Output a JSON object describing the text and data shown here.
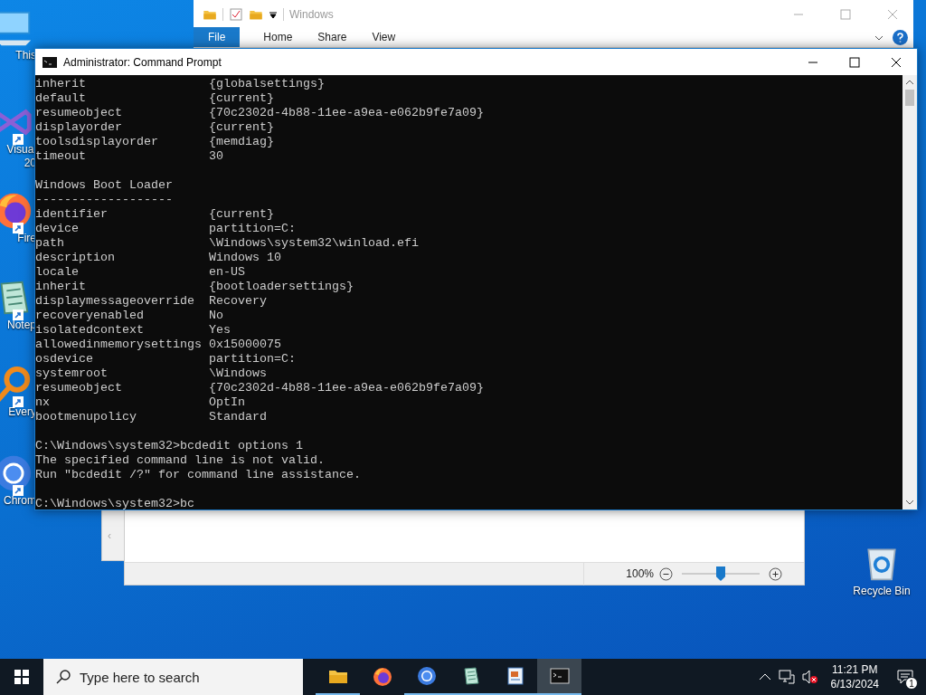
{
  "desktop_icons": [
    {
      "kind": "computer",
      "shortcut": false,
      "lines": [
        "This"
      ]
    },
    {
      "kind": "vs",
      "shortcut": true,
      "lines": [
        "Visual",
        "20"
      ]
    },
    {
      "kind": "firefox",
      "shortcut": true,
      "lines": [
        "Fire"
      ]
    },
    {
      "kind": "notepad",
      "shortcut": true,
      "lines": [
        "Notep"
      ]
    },
    {
      "kind": "everything",
      "shortcut": true,
      "lines": [
        "Every"
      ]
    },
    {
      "kind": "chromium",
      "shortcut": true,
      "lines": [
        "Chrom"
      ]
    },
    {
      "kind": "recycle",
      "shortcut": false,
      "lines": [
        "Recycle Bin"
      ]
    }
  ],
  "explorer": {
    "title": "Windows",
    "tabs": [
      {
        "label": "File",
        "selected": true
      },
      {
        "label": "Home",
        "selected": false
      },
      {
        "label": "Share",
        "selected": false
      },
      {
        "label": "View",
        "selected": false
      }
    ]
  },
  "editor": {
    "scroll_arrow": "‹",
    "zoom": "100%",
    "zoom_level": {
      "level": 0.5
    }
  },
  "console": {
    "title": "Administrator: Command Prompt",
    "lines": [
      {
        "kind": "entry",
        "name": "inherit",
        "value": "{globalsettings}"
      },
      {
        "kind": "entry",
        "name": "default",
        "value": "{current}"
      },
      {
        "kind": "entry",
        "name": "resumeobject",
        "value": "{70c2302d-4b88-11ee-a9ea-e062b9fe7a09}"
      },
      {
        "kind": "entry",
        "name": "displayorder",
        "value": "{current}"
      },
      {
        "kind": "entry",
        "name": "toolsdisplayorder",
        "value": "{memdiag}"
      },
      {
        "kind": "entry",
        "name": "timeout",
        "value": "30"
      },
      {
        "kind": "blank"
      },
      {
        "kind": "text",
        "text": "Windows Boot Loader"
      },
      {
        "kind": "text",
        "text": "-------------------"
      },
      {
        "kind": "entry",
        "name": "identifier",
        "value": "{current}"
      },
      {
        "kind": "entry",
        "name": "device",
        "value": "partition=C:"
      },
      {
        "kind": "entry",
        "name": "path",
        "value": "\\Windows\\system32\\winload.efi"
      },
      {
        "kind": "entry",
        "name": "description",
        "value": "Windows 10"
      },
      {
        "kind": "entry",
        "name": "locale",
        "value": "en-US"
      },
      {
        "kind": "entry",
        "name": "inherit",
        "value": "{bootloadersettings}"
      },
      {
        "kind": "entry",
        "name": "displaymessageoverride",
        "value": "Recovery"
      },
      {
        "kind": "entry",
        "name": "recoveryenabled",
        "value": "No"
      },
      {
        "kind": "entry",
        "name": "isolatedcontext",
        "value": "Yes"
      },
      {
        "kind": "entry",
        "name": "allowedinmemorysettings",
        "value": "0x15000075"
      },
      {
        "kind": "entry",
        "name": "osdevice",
        "value": "partition=C:"
      },
      {
        "kind": "entry",
        "name": "systemroot",
        "value": "\\Windows"
      },
      {
        "kind": "entry",
        "name": "resumeobject",
        "value": "{70c2302d-4b88-11ee-a9ea-e062b9fe7a09}"
      },
      {
        "kind": "entry",
        "name": "nx",
        "value": "OptIn"
      },
      {
        "kind": "entry",
        "name": "bootmenupolicy",
        "value": "Standard"
      },
      {
        "kind": "blank"
      },
      {
        "kind": "text",
        "text": "C:\\Windows\\system32>bcdedit options 1"
      },
      {
        "kind": "text",
        "text": "The specified command line is not valid."
      },
      {
        "kind": "text",
        "text": "Run \"bcdedit /?\" for command line assistance."
      },
      {
        "kind": "blank"
      },
      {
        "kind": "text",
        "text": "C:\\Windows\\system32>bc"
      }
    ]
  },
  "taskbar": {
    "search_placeholder": "Type here to search",
    "apps": [
      {
        "kind": "folder",
        "open": true,
        "selected": false
      },
      {
        "kind": "firefox",
        "open": false,
        "selected": false
      },
      {
        "kind": "chromium",
        "open": true,
        "selected": false
      },
      {
        "kind": "notepad",
        "open": true,
        "selected": false
      },
      {
        "kind": "wordpad",
        "open": true,
        "selected": false
      },
      {
        "kind": "terminal",
        "open": true,
        "selected": true
      }
    ],
    "time": "11:21 PM",
    "date": "6/13/2024",
    "notifications": "1"
  }
}
